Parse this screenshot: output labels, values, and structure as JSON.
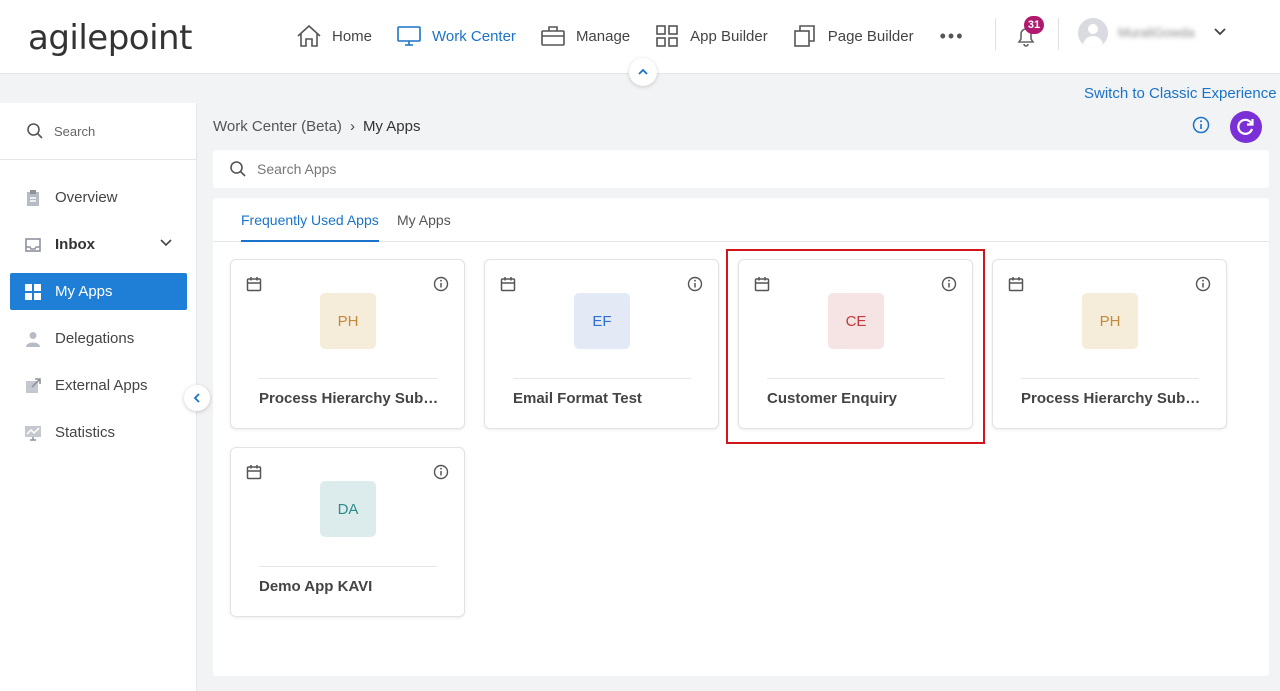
{
  "header": {
    "logo_text": "agilepoint",
    "nav": [
      {
        "label": "Home",
        "icon": "home-icon",
        "active": false
      },
      {
        "label": "Work Center",
        "icon": "monitor-icon",
        "active": true
      },
      {
        "label": "Manage",
        "icon": "briefcase-icon",
        "active": false
      },
      {
        "label": "App Builder",
        "icon": "grid-icon",
        "active": false
      },
      {
        "label": "Page Builder",
        "icon": "copy-icon",
        "active": false
      }
    ],
    "more_label": "•••",
    "notification_count": "31",
    "username": "MuraliGowda"
  },
  "switch_link": "Switch to Classic Experience",
  "sidebar": {
    "search_placeholder": "Search",
    "items": [
      {
        "label": "Overview",
        "icon": "clipboard-icon"
      },
      {
        "label": "Inbox",
        "icon": "inbox-icon"
      },
      {
        "label": "My Apps",
        "icon": "apps-grid-icon"
      },
      {
        "label": "Delegations",
        "icon": "person-icon"
      },
      {
        "label": "External Apps",
        "icon": "external-link-icon"
      },
      {
        "label": "Statistics",
        "icon": "chart-icon"
      }
    ]
  },
  "breadcrumb": {
    "parent": "Work Center (Beta)",
    "separator": "›",
    "current": "My Apps"
  },
  "search": {
    "placeholder": "Search Apps"
  },
  "tabs": [
    {
      "label": "Frequently Used Apps",
      "active": true
    },
    {
      "label": "My Apps",
      "active": false
    }
  ],
  "apps": [
    {
      "initials": "PH",
      "title": "Process Hierarchy Subprocess",
      "tile_bg": "#f6ecda",
      "tile_fg": "#c08a3a"
    },
    {
      "initials": "EF",
      "title": "Email Format Test",
      "tile_bg": "#e3eaf6",
      "tile_fg": "#2f6fcf"
    },
    {
      "initials": "CE",
      "title": "Customer Enquiry",
      "tile_bg": "#f6e4e4",
      "tile_fg": "#c0393b"
    },
    {
      "initials": "PH",
      "title": "Process Hierarchy Subprocess",
      "tile_bg": "#f6ecda",
      "tile_fg": "#c08a3a"
    },
    {
      "initials": "DA",
      "title": "Demo App KAVI",
      "tile_bg": "#dcecec",
      "tile_fg": "#2f8a8a"
    }
  ],
  "colors": {
    "accent": "#1a73c8",
    "active_nav_bg": "#1f7fd6",
    "refresh_button": "#7b2fd6",
    "badge": "#b0196e",
    "highlight": "#d0161b"
  }
}
